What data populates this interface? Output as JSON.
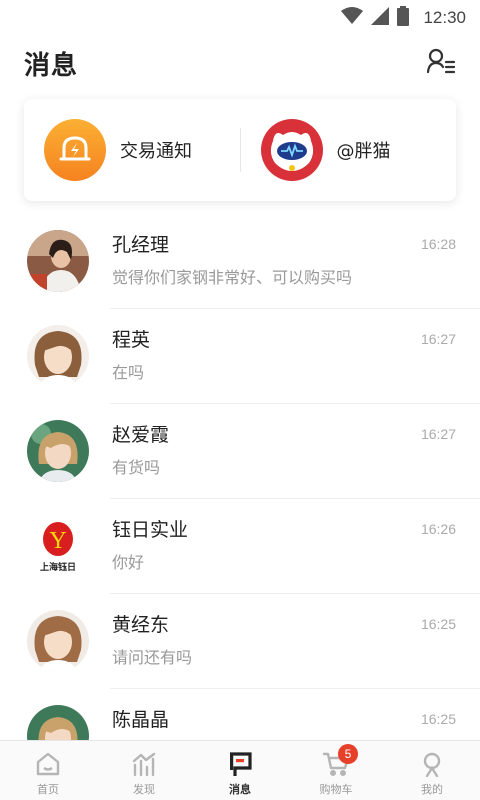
{
  "status_bar": {
    "time": "12:30"
  },
  "header": {
    "title": "消息"
  },
  "top_card": {
    "items": [
      {
        "label": "交易通知"
      },
      {
        "label": "@胖猫"
      }
    ]
  },
  "messages": [
    {
      "name": "孔经理",
      "preview": "觉得你们家钢非常好、可以购买吗",
      "time": "16:28"
    },
    {
      "name": "程英",
      "preview": "在吗",
      "time": "16:27"
    },
    {
      "name": "赵爱霞",
      "preview": "有货吗",
      "time": "16:27"
    },
    {
      "name": "钰日实业",
      "preview": "你好",
      "time": "16:26",
      "logo_letter": "Y",
      "logo_caption": "上海钰日"
    },
    {
      "name": "黄经东",
      "preview": "请问还有吗",
      "time": "16:25"
    },
    {
      "name": "陈晶晶",
      "preview": "",
      "time": "16:25"
    }
  ],
  "tab_bar": {
    "tabs": [
      {
        "label": "首页"
      },
      {
        "label": "发现"
      },
      {
        "label": "消息"
      },
      {
        "label": "购物车",
        "badge": "5"
      },
      {
        "label": "我的"
      }
    ]
  },
  "colors": {
    "accent": "#e6402b",
    "active_tab": "#e6402b",
    "inactive_tab": "#aaaaaa"
  }
}
